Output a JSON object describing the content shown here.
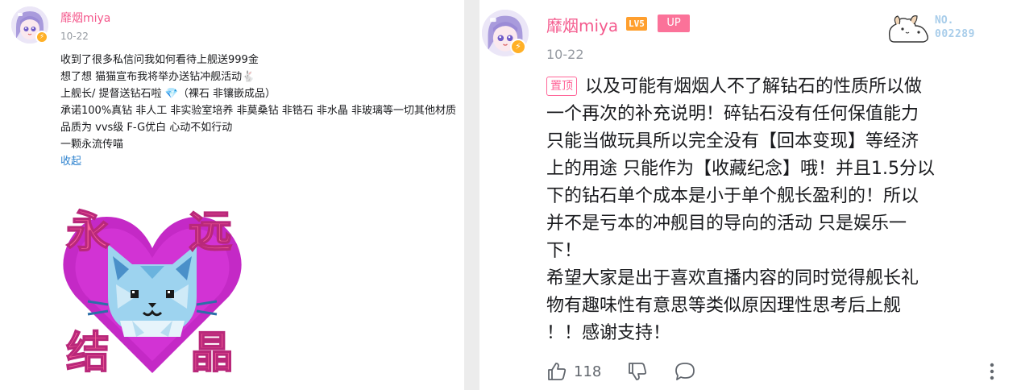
{
  "left_comment": {
    "username": "靡烟miya",
    "date": "10-22",
    "lines": [
      "收到了很多私信问我如何看待上舰送999金",
      "想了想 猫猫宣布我将举办送钻冲舰活动🐇",
      "上舰长/ 提督送钻石啦 💎（裸石 非镶嵌成品）",
      "承诺100%真钻 非人工 非实验室培养 非莫桑钻 非锆石 非水晶 非玻璃等一切其他材质",
      "品质为 vvs级 F-G优白 心动不如行动",
      "一颗永流传喵"
    ],
    "collapse_label": "收起",
    "sticker_text": [
      "永",
      "远",
      "结",
      "晶"
    ]
  },
  "right_comment": {
    "username": "靡烟miya",
    "level": "LV5",
    "up_badge": "UP",
    "date": "10-22",
    "fan_card": {
      "no_label": "NO.",
      "no_value": "002289"
    },
    "pinned_label": "置顶",
    "lines": [
      "以及可能有烟烟人不了解钻石的性质所以做",
      "一个再次的补充说明！碎钻石没有任何保值能力",
      "只能当做玩具所以完全没有【回本变现】等经济",
      "上的用途 只能作为【收藏纪念】哦！并且1.5分以",
      "下的钻石单个成本是小于单个舰长盈利的！所以",
      "并不是亏本的冲舰目的导向的活动 只是娱乐一",
      "下！",
      "希望大家是出于喜欢直播内容的同时觉得舰长礼",
      "物有趣味性有意思等类似原因理性思考后上舰",
      "！！感谢支持！"
    ],
    "like_count": "118"
  },
  "colors": {
    "username": "#f45a8d",
    "link": "#2f83cf",
    "up_badge": "#fb7299",
    "level_badge": "#ff9f2e",
    "sticker_heart": "#c429c6",
    "sticker_text": "#f7619a"
  },
  "icons": [
    "thumb-up-icon",
    "thumb-down-icon",
    "comment-bubble-icon",
    "more-vertical-icon",
    "vip-badge-icon",
    "diamond-icon",
    "bunny-emoji-icon"
  ]
}
